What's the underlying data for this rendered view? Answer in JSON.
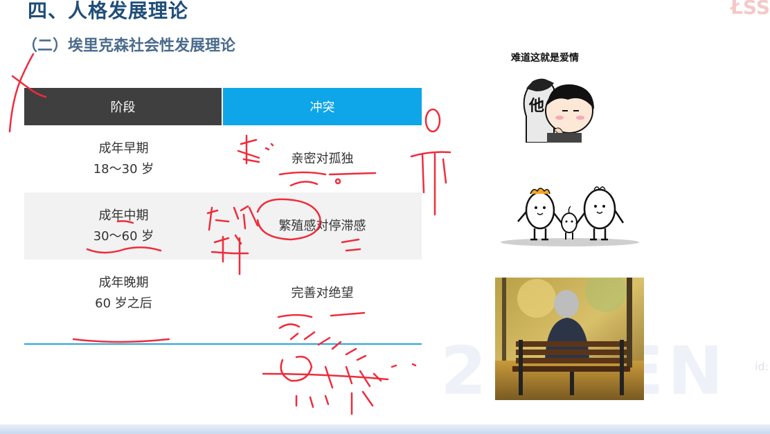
{
  "title": "四、人格发展理论",
  "subtitle": "（二）埃里克森社会性发展理论",
  "table": {
    "headers": {
      "stage": "阶段",
      "conflict": "冲突"
    },
    "rows": [
      {
        "stage_name": "成年早期",
        "stage_age": "18～30 岁",
        "conflict": "亲密对孤独"
      },
      {
        "stage_name": "成年中期",
        "stage_age": "30～60 岁",
        "conflict": "繁殖感对停滞感"
      },
      {
        "stage_name": "成年晚期",
        "stage_age": "60 岁之后",
        "conflict": "完善对绝望"
      }
    ]
  },
  "images": {
    "caption": "难道这就是爱情",
    "meme_text": "他"
  },
  "watermark": {
    "text": "20  FEN",
    "id": "id:"
  },
  "colors": {
    "header_dark": "#3f3f3f",
    "header_blue": "#0ea5e9",
    "ink_red": "#ef2b3c",
    "title_blue": "#1f4e79"
  }
}
